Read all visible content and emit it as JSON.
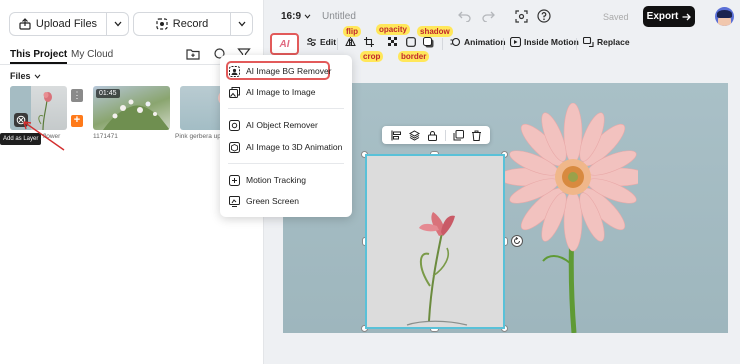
{
  "left_panel": {
    "upload_label": "Upload Files",
    "record_label": "Record",
    "tabs": {
      "project": "This Project",
      "cloud": "My Cloud"
    },
    "files_label": "Files",
    "media": [
      {
        "name": "flower"
      },
      {
        "name": "1171471",
        "duration": "01:45"
      },
      {
        "name": "Pink gerbera up"
      }
    ],
    "tooltip": "Add as Layer"
  },
  "topbar": {
    "aspect_ratio": "16:9",
    "title": "Untitled",
    "saved": "Saved",
    "export": "Export"
  },
  "toolbar": {
    "ai_label": "AI",
    "edit": "Edit",
    "animation": "Animation",
    "inside_motion": "Inside Motion",
    "replace": "Replace",
    "annotations": {
      "flip": "flip",
      "opacity": "opacity",
      "shadow": "shadow",
      "crop": "crop",
      "border": "border"
    }
  },
  "ai_menu": {
    "items": [
      {
        "label": "AI Image BG Remover",
        "highlighted": true
      },
      {
        "label": "AI Image to Image"
      },
      {
        "label": "AI Object Remover"
      },
      {
        "label": "AI Image to 3D Animation"
      },
      {
        "label": "Motion Tracking"
      },
      {
        "label": "Green Screen"
      }
    ]
  },
  "colors": {
    "accent_red": "#e25a5a",
    "export_bg": "#111111",
    "add_orange": "#ff7a1a",
    "selection_cyan": "#59c1d8",
    "annotation_yellow": "#ffe75a"
  }
}
